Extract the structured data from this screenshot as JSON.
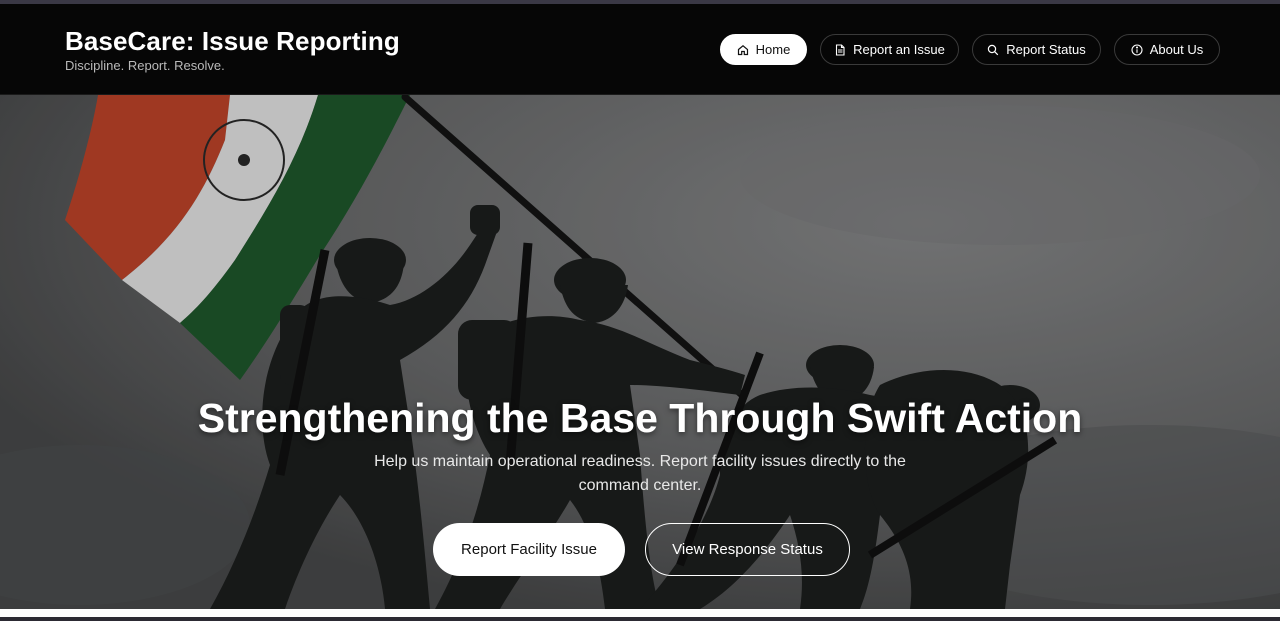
{
  "brand": {
    "title": "BaseCare: Issue Reporting",
    "tagline": "Discipline. Report. Resolve."
  },
  "nav": {
    "items": [
      {
        "label": "Home",
        "icon": "home-icon",
        "active": true
      },
      {
        "label": "Report an Issue",
        "icon": "document-icon",
        "active": false
      },
      {
        "label": "Report Status",
        "icon": "search-icon",
        "active": false
      },
      {
        "label": "About Us",
        "icon": "info-icon",
        "active": false
      }
    ]
  },
  "hero": {
    "title": "Strengthening the Base Through Swift Action",
    "subtitle": "Help us maintain operational readiness. Report facility issues directly to the command center.",
    "primary_cta": "Report Facility Issue",
    "secondary_cta": "View Response Status",
    "image": "soldiers-raising-flag-statue",
    "flag_colors": [
      "#c2452a",
      "#e9e9e9",
      "#1f5a2c"
    ]
  }
}
